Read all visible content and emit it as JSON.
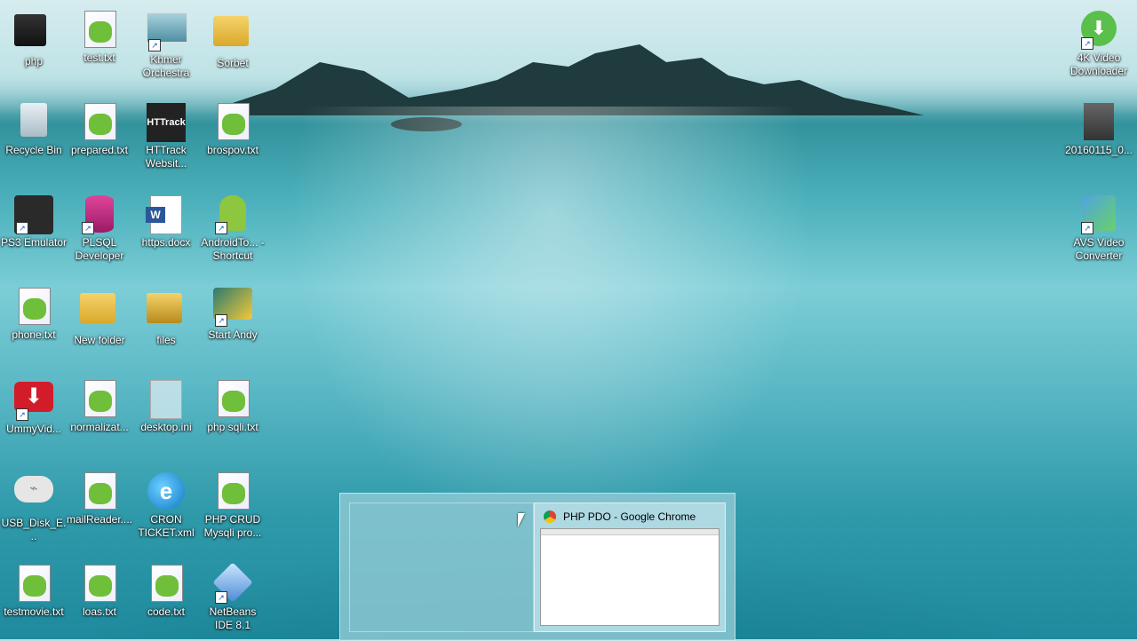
{
  "desktop": {
    "icons": [
      {
        "label": "php"
      },
      {
        "label": "test.txt"
      },
      {
        "label": "Khmer Orchestra"
      },
      {
        "label": "Sorbet"
      },
      {
        "label": "Recycle Bin"
      },
      {
        "label": "prepared.txt"
      },
      {
        "label": "HTTrack Websit..."
      },
      {
        "label": "brospov.txt"
      },
      {
        "label": "PS3 Emulator"
      },
      {
        "label": "PLSQL Developer"
      },
      {
        "label": "https.docx"
      },
      {
        "label": "AndroidTo... - Shortcut"
      },
      {
        "label": "phone.txt"
      },
      {
        "label": "New folder"
      },
      {
        "label": "files"
      },
      {
        "label": "Start Andy"
      },
      {
        "label": "UmmyVid..."
      },
      {
        "label": "normalizat..."
      },
      {
        "label": "desktop.ini"
      },
      {
        "label": "php sqli.txt"
      },
      {
        "label": "USB_Disk_E..."
      },
      {
        "label": "mailReader...."
      },
      {
        "label": "CRON TICKET.xml"
      },
      {
        "label": "PHP CRUD Mysqli pro..."
      },
      {
        "label": "testmovie.txt"
      },
      {
        "label": "loas.txt"
      },
      {
        "label": "code.txt"
      },
      {
        "label": "NetBeans IDE 8.1"
      },
      {
        "label": "4K Video Downloader"
      },
      {
        "label": "20160115_0..."
      },
      {
        "label": "AVS Video Converter"
      }
    ]
  },
  "taskbar_preview": {
    "window_title": "PHP PDO - Google Chrome"
  },
  "colors": {
    "accent": "#2f9aaa",
    "chrome_red": "#db4437",
    "chrome_yellow": "#f4c20d",
    "chrome_green": "#0f9d58"
  }
}
